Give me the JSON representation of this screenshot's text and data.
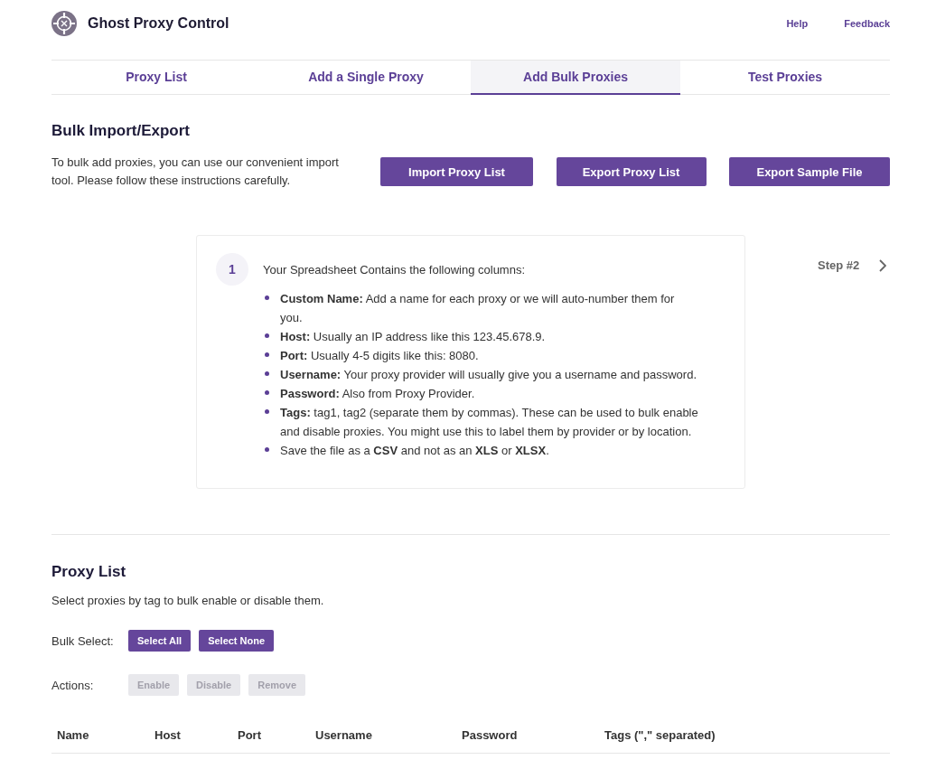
{
  "header": {
    "title": "Ghost Proxy Control",
    "links": [
      "Help",
      "Feedback"
    ]
  },
  "tabs": [
    {
      "label": "Proxy List",
      "selected": false
    },
    {
      "label": "Add a Single Proxy",
      "selected": false
    },
    {
      "label": "Add Bulk Proxies",
      "selected": true
    },
    {
      "label": "Test Proxies",
      "selected": false
    }
  ],
  "bulk_section": {
    "heading": "Bulk Import/Export",
    "description": "To bulk add proxies, you can use our convenient import tool. Please follow these instructions carefully.",
    "buttons": [
      "Import Proxy List",
      "Export Proxy List",
      "Export Sample File"
    ]
  },
  "step_card": {
    "number": "1",
    "title": "Your Spreadsheet Contains the following columns:",
    "items": [
      "**Custom Name:** Add a name for each proxy or we will auto-number them for you.",
      "**Host:** Usually an IP address like this 123.45.678.9.",
      "**Port:** Usually 4-5 digits like this: 8080.",
      "**Username:** Your proxy provider will usually give you a username and password.",
      "**Password:** Also from Proxy Provider.",
      "**Tags:** tag1, tag2 (separate them by commas). These can be used to bulk enable and disable proxies. You might use this to label them by provider or by location.",
      "Save the file as a **CSV** and not as an **XLS** or **XLSX**."
    ],
    "next_label": "Step #2"
  },
  "proxy_list": {
    "heading": "Proxy List",
    "description": "Select proxies by tag to bulk enable or disable them.",
    "bulk_select": {
      "label": "Bulk Select:",
      "buttons": [
        {
          "label": "Select All",
          "disabled": false
        },
        {
          "label": "Select None",
          "disabled": false
        }
      ]
    },
    "actions": {
      "label": "Actions:",
      "buttons": [
        {
          "label": "Enable",
          "disabled": true
        },
        {
          "label": "Disable",
          "disabled": true
        },
        {
          "label": "Remove",
          "disabled": true
        }
      ]
    },
    "table": {
      "columns": [
        "Name",
        "Host",
        "Port",
        "Username",
        "Password",
        "Tags (\",\" separated)"
      ]
    }
  }
}
